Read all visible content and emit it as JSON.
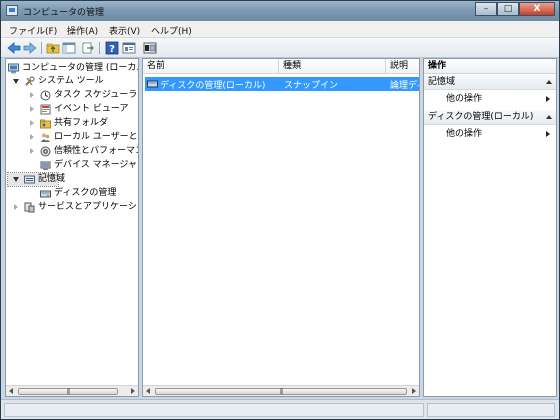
{
  "window": {
    "title": "コンピュータの管理",
    "minimize": "–",
    "maximize": "□",
    "close": "X"
  },
  "menu": [
    "ファイル(F)",
    "操作(A)",
    "表示(V)",
    "ヘルプ(H)"
  ],
  "toolbar": {
    "icons": [
      "back-arrow-icon",
      "forward-arrow-icon",
      "folder-up-icon",
      "show-hide-tree-icon",
      "export-list-icon",
      "help-icon",
      "properties-icon",
      "disk-icon"
    ]
  },
  "tree": {
    "root": "コンピュータの管理 (ローカル)",
    "system_tools": "システム ツール",
    "task_scheduler": "タスク スケジューラ",
    "event_viewer": "イベント ビューア",
    "shared_folders": "共有フォルダ",
    "local_users": "ローカル ユーザーとグループ",
    "reliability": "信頼性とパフォーマンス",
    "device_manager": "デバイス マネージャ",
    "storage": "記憶域",
    "disk_management": "ディスクの管理",
    "services_apps": "サービスとアプリケーション"
  },
  "list": {
    "columns": [
      "名前",
      "種類",
      "説明"
    ],
    "rows": [
      {
        "name": "ディスクの管理(ローカル)",
        "type": "スナップイン",
        "description": "論理ディスク"
      }
    ]
  },
  "actions": {
    "header": "操作",
    "sections": [
      {
        "title": "記憶域",
        "items": [
          "他の操作"
        ]
      },
      {
        "title": "ディスクの管理(ローカル)",
        "items": [
          "他の操作"
        ]
      }
    ]
  },
  "scroll_thumb": "|||",
  "colors": {
    "selection": "#3399ff",
    "titlebar": "#7e9ab2"
  }
}
